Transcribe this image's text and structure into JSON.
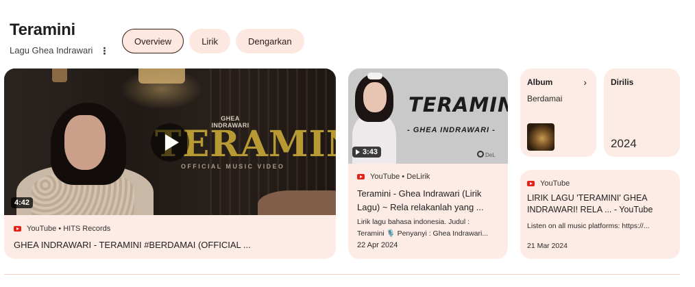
{
  "header": {
    "title": "Teramini",
    "subtitle": "Lagu Ghea Indrawari"
  },
  "chips": [
    {
      "label": "Overview",
      "active": true
    },
    {
      "label": "Lirik",
      "active": false
    },
    {
      "label": "Dengarkan",
      "active": false
    }
  ],
  "video1": {
    "duration": "4:42",
    "thumb_artist": "GHEA INDRAWARI",
    "thumb_title": "TERAMINI",
    "thumb_sub": "OFFICIAL MUSIC VIDEO",
    "source": "YouTube • HITS Records",
    "title": "GHEA INDRAWARI - TERAMINI #BERDAMAI (OFFICIAL ..."
  },
  "video2": {
    "duration": "3:43",
    "thumb_title": "TERAMINI",
    "thumb_artist": "- GHEA INDRAWARI -",
    "watermark": "DeL",
    "source": "YouTube • DeLirik",
    "title": "Teramini - Ghea Indrawari (Lirik Lagu) ~ Rela relakanlah yang ...",
    "description": "Lirik lagu bahasa indonesia. Judul : Teramini 🎙️ Penyanyi : Ghea Indrawari...",
    "date": "22 Apr 2024"
  },
  "album": {
    "label": "Album",
    "value": "Berdamai"
  },
  "released": {
    "label": "Dirilis",
    "value": "2024"
  },
  "video3": {
    "source": "YouTube",
    "title": "LIRIK LAGU 'TERAMINI' GHEA INDRAWARI! RELA ... - YouTube",
    "description": "Listen on all music platforms: https://...",
    "date": "21 Mar 2024"
  },
  "colors": {
    "card_bg": "#fde8e1",
    "youtube_red": "#e62117",
    "active_chip_border": "#3a1d17"
  }
}
